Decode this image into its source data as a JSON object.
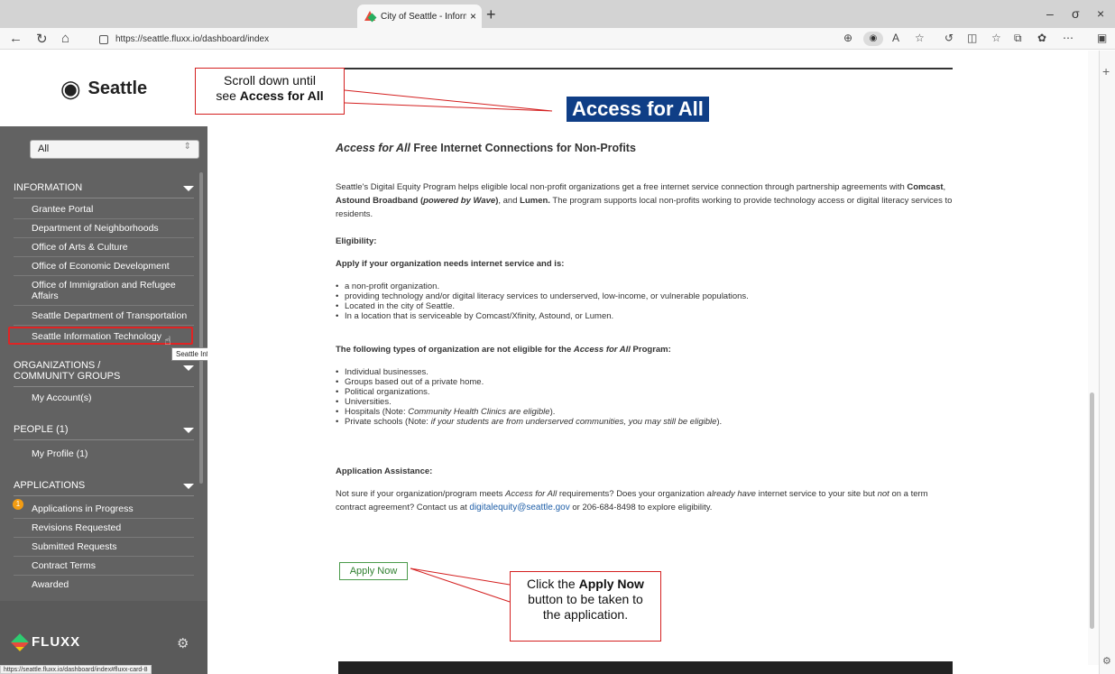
{
  "browser": {
    "tab_title": "City of Seattle - Information | Se",
    "tab_close": "×",
    "new_tab": "+",
    "url": "https://seattle.fluxx.io/dashboard/index",
    "status_url": "https://seattle.fluxx.io/dashboard/index#fluxx-card-8",
    "window_controls": [
      "–",
      "σ",
      "×"
    ],
    "nav_icons": [
      "arrow-left-icon",
      "refresh-icon",
      "home-icon"
    ],
    "toolbar_icons": [
      "zoom-icon",
      "tracking-prevention-icon",
      "read-aloud-icon",
      "favorite-icon",
      "extensions-icon",
      "split-screen-icon",
      "favorites-icon",
      "collections-icon",
      "copilot-icon",
      "more-icon",
      "sidebar-icon"
    ]
  },
  "sidebar": {
    "logo_text": "Seattle",
    "filter_value": "All",
    "sections": [
      {
        "title": "INFORMATION",
        "items": [
          "Grantee Portal",
          "Department of Neighborhoods",
          "Office of Arts & Culture",
          "Office of Economic Development",
          "Office of Immigration and Refugee Affairs",
          "Seattle Department of Transportation",
          "Seattle Information Technology"
        ]
      },
      {
        "title": "ORGANIZATIONS / COMMUNITY GROUPS",
        "items": [
          "My Account(s)"
        ]
      },
      {
        "title": "PEOPLE (1)",
        "items": [
          "My Profile  (1)"
        ]
      },
      {
        "title": "APPLICATIONS",
        "items": [
          "Applications in Progress",
          "Revisions Requested",
          "Submitted Requests",
          "Contract Terms",
          "Awarded"
        ]
      }
    ],
    "profile_badge": "1",
    "tooltip": "Seattle Information Technology",
    "brand": "FLUXX"
  },
  "main": {
    "heading": "Access for All",
    "subtitle_em": "Access for All",
    "subtitle_rest": " Free Internet Connections for Non-Profits",
    "intro": {
      "p1": "Seattle's Digital Equity Program helps eligible local non-profit organizations get a free internet service connection through partnership agreements with ",
      "comcast": "Comcast",
      "sep1": ", ",
      "astound": "Astound Broadband (",
      "powered": "powered by Wave",
      "astound_end": ")",
      "sep2": ", and ",
      "lumen": "Lumen.",
      "p2": " The program supports local non-profits working to provide technology access or digital literacy services to residents."
    },
    "eligibility_label": "Eligibility:",
    "apply_if": "Apply if your organization needs internet service and is:",
    "eligible_list": [
      "a non-profit organization.",
      "providing technology and/or digital literacy services to underserved, low-income, or vulnerable populations.",
      "Located in the city of Seattle.",
      "In a location that is serviceable by Comcast/Xfinity, Astound, or Lumen."
    ],
    "not_eligible_pre": "The following types of organization are not eligible for the ",
    "not_eligible_em": "Access for All",
    "not_eligible_post": " Program:",
    "ineligible_list": [
      {
        "text": "Individual businesses.",
        "em": ""
      },
      {
        "text": "Groups based out of a private home.",
        "em": ""
      },
      {
        "text": "Political organizations.",
        "em": ""
      },
      {
        "text": "Universities.",
        "em": ""
      },
      {
        "text": "Hospitals (Note: ",
        "em": "Community Health Clinics are eligible",
        "end": ")."
      },
      {
        "text": "Private schools (Note: ",
        "em": "if your students are from underserved communities, you may still be eligible",
        "end": ")."
      }
    ],
    "assistance_label": "Application Assistance:",
    "assist": {
      "a1": "Not sure if your organization/program meets ",
      "a_em1": "Access for All",
      "a2": " requirements? Does your organization ",
      "a_em2": "already have",
      "a3": " internet service to your site but ",
      "a_em3": "not",
      "a4": " on a term contract agreement? Contact us at ",
      "email": "digitalequity@seattle.gov",
      "a5": " or 206-684-8498 to explore eligibility."
    },
    "apply_button": "Apply Now"
  },
  "callouts": {
    "scroll_line1": "Scroll down until",
    "scroll_line2_pre": "see ",
    "scroll_line2_bold": "Access for All",
    "click_pre": "Click the ",
    "click_bold": "Apply Now",
    "click_line2": "button to be taken to",
    "click_line3": "the application."
  },
  "colors": {
    "sidebar_bg": "#626262",
    "heading_highlight": "#0f3e86",
    "callout_border": "#d42020",
    "apply_button_border": "#4a9a4a"
  }
}
